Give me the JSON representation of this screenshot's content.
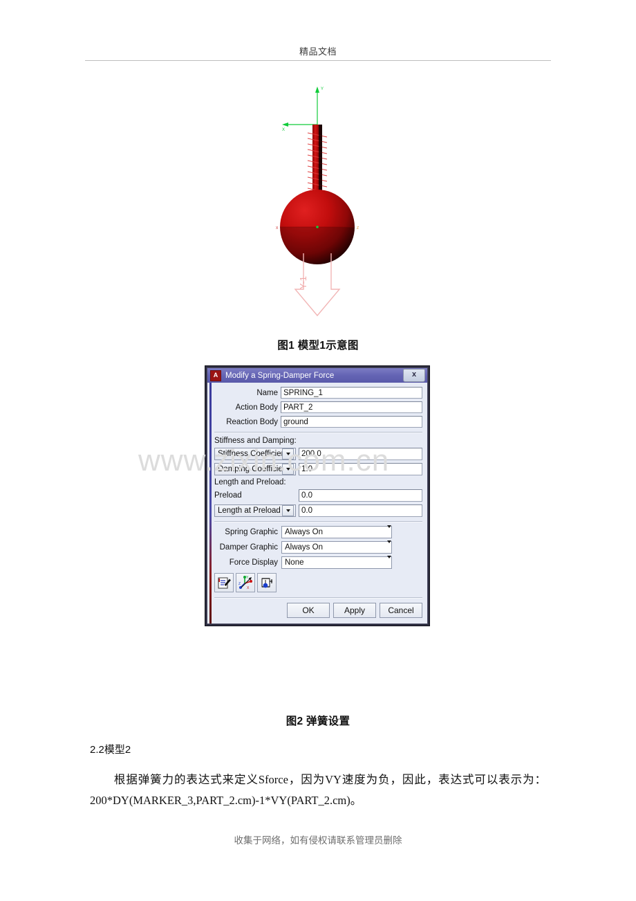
{
  "page": {
    "header_text": "精品文档",
    "footer_text": "收集于网络，如有侵权请联系管理员删除",
    "watermark": "www.zixin.com.cn"
  },
  "figure1": {
    "caption": "图1 模型1示意图",
    "axis_labels": {
      "y": "Y",
      "x": "X"
    },
    "force_label": "Y-1",
    "colors": {
      "body": "#c00000",
      "axis": "#00cc33",
      "force_arrow": "#ffb3b3"
    }
  },
  "figure2": {
    "caption": "图2 弹簧设置"
  },
  "dialog": {
    "app_badge": "A",
    "title": "Modify a Spring-Damper Force",
    "close_label": "x",
    "fields": [
      {
        "label": "Name",
        "value": "SPRING_1"
      },
      {
        "label": "Action Body",
        "value": "PART_2"
      },
      {
        "label": "Reaction Body",
        "value": "ground"
      }
    ],
    "stiffness_group_label": "Stiffness and Damping:",
    "stiffness": {
      "combo": "Stiffness Coefficient",
      "value": "200.0"
    },
    "damping": {
      "combo": "Damping Coefficient",
      "value": "1.0"
    },
    "length_group_label": "Length and Preload:",
    "preload": {
      "label": "Preload",
      "value": "0.0"
    },
    "length_at_preload": {
      "combo": "Length at Preload",
      "value": "0.0"
    },
    "graphics": [
      {
        "label": "Spring Graphic",
        "value": "Always On"
      },
      {
        "label": "Damper Graphic",
        "value": "Always On"
      },
      {
        "label": "Force Display",
        "value": "None"
      }
    ],
    "icon_buttons": [
      {
        "name": "edit-notes-icon"
      },
      {
        "name": "axes-triad-icon"
      },
      {
        "name": "damper-graphic-icon"
      }
    ],
    "buttons": [
      {
        "label": "OK"
      },
      {
        "label": "Apply"
      },
      {
        "label": "Cancel"
      }
    ],
    "colors": {
      "titlebar": "#6464b4",
      "badge": "#9b1414",
      "body": "#e7ebf5"
    }
  },
  "body": {
    "section_heading": "2.2模型2",
    "paragraph_line1": "根据弹簧力的表达式来定义Sforce，因为VY速度为负，因此，表达式可以",
    "paragraph_line2": "表示为：200*DY(MARKER_3,PART_2.cm)-1*VY(PART_2.cm)。"
  }
}
